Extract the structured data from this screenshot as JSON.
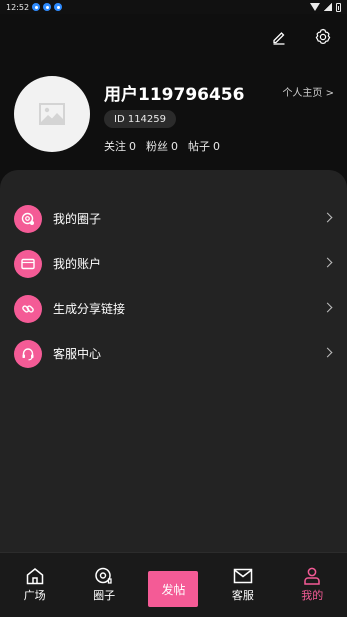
{
  "status_bar": {
    "time": "12:52",
    "notification_count": 3
  },
  "header": {
    "edit_icon": "edit-icon",
    "settings_icon": "gear-icon"
  },
  "profile": {
    "username": "用户119796456",
    "homepage_link": "个人主页 >",
    "id_text": "ID 114259",
    "stats": [
      {
        "label": "关注",
        "value": "0"
      },
      {
        "label": "粉丝",
        "value": "0"
      },
      {
        "label": "帖子",
        "value": "0"
      }
    ]
  },
  "menu": {
    "items": [
      {
        "label": "我的圈子",
        "icon": "circle-icon"
      },
      {
        "label": "我的账户",
        "icon": "wallet-icon"
      },
      {
        "label": "生成分享链接",
        "icon": "link-icon"
      },
      {
        "label": "客服中心",
        "icon": "headset-icon"
      }
    ]
  },
  "tab_bar": {
    "tabs": [
      {
        "label": "广场",
        "icon": "home-icon"
      },
      {
        "label": "圈子",
        "icon": "circle-tab-icon"
      },
      {
        "label": "发帖",
        "icon": "post-button"
      },
      {
        "label": "客服",
        "icon": "mail-icon"
      },
      {
        "label": "我的",
        "icon": "person-icon"
      }
    ]
  },
  "colors": {
    "accent": "#f45b96",
    "background": "#0f0f0f",
    "card": "#232323"
  }
}
